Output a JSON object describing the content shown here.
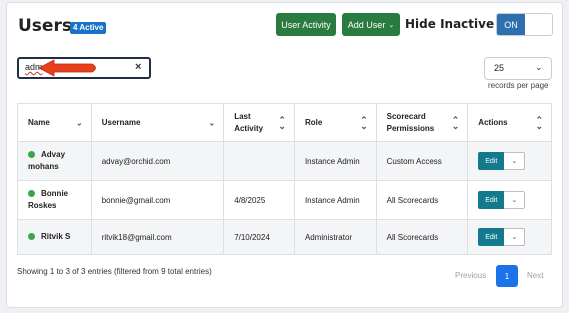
{
  "header": {
    "title": "Users",
    "active_badge": "4 Active",
    "user_activity_label": "User Activity",
    "add_user_label": "Add User",
    "hide_inactive_label": "Hide Inactive Users",
    "toggle_state": "ON"
  },
  "search": {
    "value": "adm",
    "clear_glyph": "×"
  },
  "per_page": {
    "value": "25",
    "label": "records per page"
  },
  "table": {
    "columns": [
      {
        "label": "Name",
        "sort": "chevron-down"
      },
      {
        "label": "Username",
        "sort": "chevron-down"
      },
      {
        "label": "Last Activity",
        "sort": "up-down"
      },
      {
        "label": "Role",
        "sort": "up-down"
      },
      {
        "label": "Scorecard Permissions",
        "sort": "up-down"
      },
      {
        "label": "Actions",
        "sort": "up-down"
      }
    ],
    "rows": [
      {
        "name": "Advay mohans",
        "username": "advay@orchid.com",
        "last_activity": "",
        "role": "Instance Admin",
        "permissions": "Custom Access",
        "action": "Edit"
      },
      {
        "name": "Bonnie Roskes",
        "username": "bonnie@gmail.com",
        "last_activity": "4/8/2025",
        "role": "Instance Admin",
        "permissions": "All Scorecards",
        "action": "Edit"
      },
      {
        "name": "Ritvik S",
        "username": "ritvik18@gmail.com",
        "last_activity": "7/10/2024",
        "role": "Administrator",
        "permissions": "All Scorecards",
        "action": "Edit"
      }
    ]
  },
  "footer": {
    "info": "Showing 1 to 3 of 3 entries (filtered from 9 total entries)",
    "previous": "Previous",
    "current_page": "1",
    "next": "Next"
  },
  "colors": {
    "primary_green": "#2a7b3f",
    "toggle_blue": "#2e6fad",
    "edit_teal": "#127a8c",
    "status_green": "#3aa54a",
    "annotation_arrow": "#e8401c"
  }
}
